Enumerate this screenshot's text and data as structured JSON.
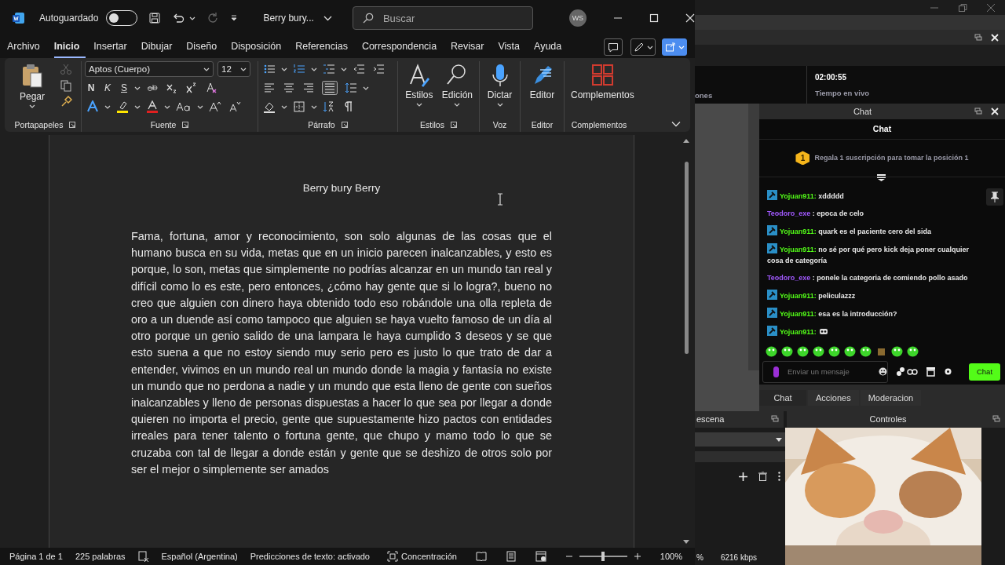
{
  "word": {
    "title_bar": {
      "autosave_label": "Autoguardado",
      "autosave_on": false,
      "doc_title": "Berry bury...",
      "search_placeholder": "Buscar",
      "avatar_initials": "WS"
    },
    "tabs": [
      {
        "label": "Archivo",
        "selected": false
      },
      {
        "label": "Inicio",
        "selected": true
      },
      {
        "label": "Insertar",
        "selected": false
      },
      {
        "label": "Dibujar",
        "selected": false
      },
      {
        "label": "Diseño",
        "selected": false
      },
      {
        "label": "Disposición",
        "selected": false
      },
      {
        "label": "Referencias",
        "selected": false
      },
      {
        "label": "Correspondencia",
        "selected": false
      },
      {
        "label": "Revisar",
        "selected": false
      },
      {
        "label": "Vista",
        "selected": false
      },
      {
        "label": "Ayuda",
        "selected": false
      }
    ],
    "ribbon": {
      "paste_label": "Pegar",
      "font_name": "Aptos (Cuerpo)",
      "font_size": "12",
      "format_letters": [
        "N",
        "K",
        "S"
      ],
      "big_buttons": [
        {
          "kind": "styles",
          "label": "Estilos"
        },
        {
          "kind": "find",
          "label": "Edición"
        },
        {
          "kind": "dictate",
          "label": "Dictar"
        },
        {
          "kind": "editor",
          "label": "Editor"
        },
        {
          "kind": "addins",
          "label": "Complementos"
        }
      ],
      "group_labels": [
        "Portapapeles",
        "Fuente",
        "Párrafo",
        "Estilos",
        "Voz",
        "Editor",
        "Complementos"
      ]
    },
    "document": {
      "title": "Berry bury Berry",
      "paragraph": "Fama, fortuna, amor y reconocimiento, son solo algunas de las cosas que el humano busca en su vida, metas que en un inicio parecen inalcanzables, y esto es porque, lo son, metas que simplemente no podrías alcanzar en un mundo tan real y difícil como lo es este, pero entonces, ¿cómo hay gente que si lo logra?, bueno no creo que alguien con dinero haya obtenido todo eso robándole una olla repleta de oro a un duende así como tampoco que alguien se haya vuelto famoso de un día al otro porque un genio salido de una lampara le haya cumplido 3 deseos y se que esto suena a que no estoy siendo muy serio pero es justo lo que trato de dar a entender, vivimos en un mundo real un mundo donde la magia y fantasía no existe un mundo que no perdona a nadie y un mundo que esta lleno de gente con sueños inalcanzables y lleno de personas dispuestas a hacer lo que sea por llegar a donde quieren no importa el precio, gente que supuestamente hizo pactos con entidades irreales para tener talento o fortuna gente, que chupo y mamo todo lo que se cruzaba con tal de llegar a donde están y gente que se deshizo de otros solo por ser el mejor o simplemente ser amados"
    },
    "status_bar": {
      "page": "Página 1 de 1",
      "words": "225 palabras",
      "language": "Español (Argentina)",
      "predictions": "Predicciones de texto: activado",
      "focus": "Concentración",
      "zoom": {
        "level": 0.5
      },
      "zoom_percent": "100%"
    }
  },
  "stream_app": {
    "stats": {
      "cut_label": "ones",
      "live_time": "02:00:55",
      "live_time_label": "Tiempo en vivo"
    },
    "chat": {
      "dock_title": "Chat",
      "header": "Chat",
      "banner_rank": "1",
      "banner": "Regala 1 suscripción para tomar la posición 1",
      "messages": [
        {
          "kind": "text",
          "user": "Yojuan911:",
          "color": "#53fc18",
          "badge": true,
          "text": "xddddd"
        },
        {
          "kind": "text",
          "user": "Teodoro_exe",
          "color": "#a259ff",
          "badge": false,
          "text": ": epoca de celo"
        },
        {
          "kind": "text",
          "user": "Yojuan911:",
          "color": "#53fc18",
          "badge": true,
          "text": "quark es el paciente cero del sida"
        },
        {
          "kind": "text",
          "user": "Yojuan911:",
          "color": "#53fc18",
          "badge": true,
          "text": "no sé por qué pero kick deja poner cualquier cosa de categoría"
        },
        {
          "kind": "text",
          "user": "Teodoro_exe",
          "color": "#a259ff",
          "badge": false,
          "text": ": ponele la categoria de comiendo pollo asado"
        },
        {
          "kind": "text",
          "user": "Yojuan911:",
          "color": "#53fc18",
          "badge": true,
          "text": "peliculazzz"
        },
        {
          "kind": "text",
          "user": "Yojuan911:",
          "color": "#53fc18",
          "badge": true,
          "text": "esa es la introducción?"
        },
        {
          "kind": "emote",
          "user": "Yojuan911:",
          "color": "#53fc18",
          "badge": true
        }
      ],
      "input_placeholder": "Enviar un mensaje",
      "send_label": "Chat",
      "tabs": [
        {
          "label": "Chat",
          "selected": true
        },
        {
          "label": "Acciones",
          "selected": false
        },
        {
          "label": "Moderacion",
          "selected": false
        }
      ]
    },
    "docks": [
      {
        "title": "escena"
      },
      {
        "title": "Controles"
      }
    ],
    "status": {
      "cut_percent": "%",
      "bitrate": "6216 kbps"
    }
  }
}
